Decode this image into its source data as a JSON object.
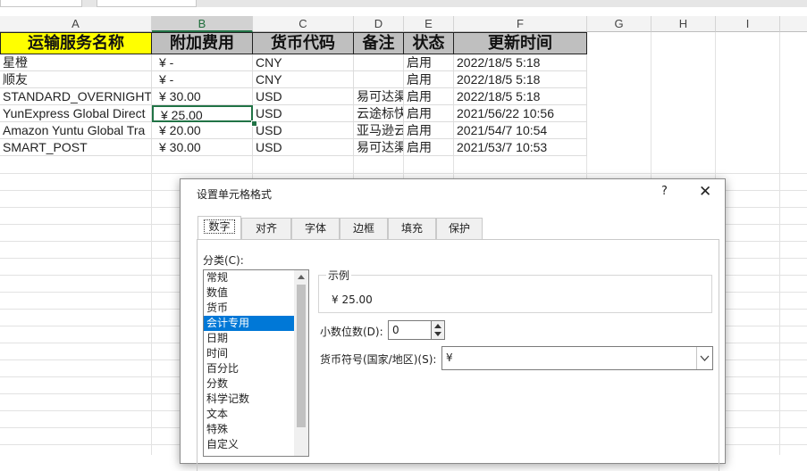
{
  "columns": [
    "A",
    "B",
    "C",
    "D",
    "E",
    "F",
    "G",
    "H",
    "I"
  ],
  "header_row": [
    "运输服务名称",
    "附加费用",
    "货币代码",
    "备注",
    "状态",
    "更新时间"
  ],
  "rows": [
    [
      "星橙",
      "¥ -",
      "CNY",
      "",
      "启用",
      "2022/18/5 5:18"
    ],
    [
      "顺友",
      "¥ -",
      "CNY",
      "",
      "启用",
      "2022/18/5 5:18"
    ],
    [
      "STANDARD_OVERNIGHT",
      "¥ 30.00",
      "USD",
      "易可达渠",
      "启用",
      "2022/18/5 5:18"
    ],
    [
      "YunExpress Global Direct",
      "¥ 25.00",
      "USD",
      "云途标快",
      "启用",
      "2021/56/22 10:56"
    ],
    [
      "Amazon Yuntu Global Tra",
      "¥ 20.00",
      "USD",
      "亚马逊云",
      "启用",
      "2021/54/7 10:54"
    ],
    [
      "SMART_POST",
      "¥ 30.00",
      "USD",
      "易可达渠",
      "启用",
      "2021/53/7 10:53"
    ]
  ],
  "dialog": {
    "title": "设置单元格格式",
    "help": "?",
    "close": "✕",
    "tabs": [
      "数字",
      "对齐",
      "字体",
      "边框",
      "填充",
      "保护"
    ],
    "active_tab": "数字",
    "category_label": "分类(C):",
    "categories": [
      "常规",
      "数值",
      "货币",
      "会计专用",
      "日期",
      "时间",
      "百分比",
      "分数",
      "科学记数",
      "文本",
      "特殊",
      "自定义"
    ],
    "selected_category": "会计专用",
    "sample_label": "示例",
    "sample_value": "¥ 25.00",
    "decimal_label": "小数位数(D):",
    "decimal_value": "0",
    "currency_label": "货币符号(国家/地区)(S):",
    "currency_value": "¥"
  },
  "colors": {
    "header_fill_a": "#ffff00",
    "header_fill": "#bfbfbf",
    "selection": "#217346",
    "list_selected": "#0078d7"
  }
}
